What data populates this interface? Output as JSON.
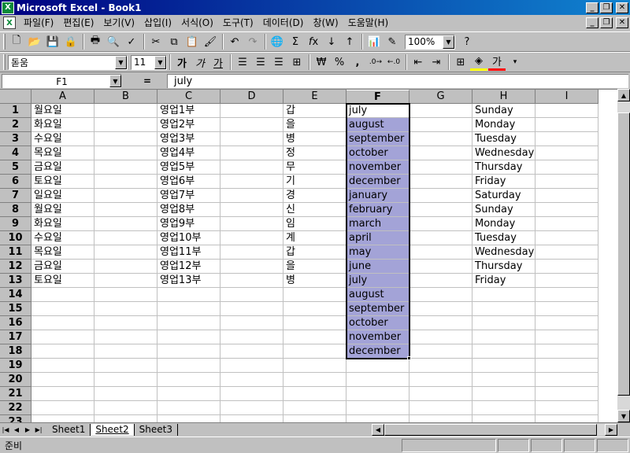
{
  "window": {
    "title": "Microsoft Excel - Book1",
    "app_icon": "excel-icon",
    "buttons": [
      "_",
      "❐",
      "✕"
    ]
  },
  "menu": {
    "items": [
      "파일(F)",
      "편집(E)",
      "보기(V)",
      "삽입(I)",
      "서식(O)",
      "도구(T)",
      "데이터(D)",
      "창(W)",
      "도움말(H)"
    ],
    "doc_buttons": [
      "_",
      "❐",
      "✕"
    ]
  },
  "standard_toolbar": {
    "zoom": "100%",
    "icons": [
      "new-icon",
      "open-icon",
      "save-icon",
      "permission-icon",
      "print-icon",
      "preview-icon",
      "spelling-icon",
      "cut-icon",
      "copy-icon",
      "paste-icon",
      "format-painter-icon",
      "undo-icon",
      "redo-icon",
      "hyperlink-icon",
      "autosum-icon",
      "function-icon",
      "sort-ascending-icon",
      "sort-descending-icon",
      "chart-wizard-icon",
      "drawing-icon",
      "help-icon"
    ]
  },
  "format_toolbar": {
    "font": "돋움",
    "size": "11",
    "bold": "가",
    "italic": "가",
    "underline": "가",
    "currency": "₩",
    "percent": "%",
    "comma": ",",
    "font_color_label": "가"
  },
  "formula_bar": {
    "name_box": "F1",
    "equals": "=",
    "content": "july"
  },
  "columns": [
    "A",
    "B",
    "C",
    "D",
    "E",
    "F",
    "G",
    "H",
    "I"
  ],
  "rows": [
    "1",
    "2",
    "3",
    "4",
    "5",
    "6",
    "7",
    "8",
    "9",
    "10",
    "11",
    "12",
    "13",
    "14",
    "15",
    "16",
    "17",
    "18",
    "19",
    "20",
    "21",
    "22",
    "23"
  ],
  "cells": {
    "A": [
      "월요일",
      "화요일",
      "수요일",
      "목요일",
      "금요일",
      "토요일",
      "일요일",
      "월요일",
      "화요일",
      "수요일",
      "목요일",
      "금요일",
      "토요일"
    ],
    "C": [
      "영업1부",
      "영업2부",
      "영업3부",
      "영업4부",
      "영업5부",
      "영업6부",
      "영업7부",
      "영업8부",
      "영업9부",
      "영업10부",
      "영업11부",
      "영업12부",
      "영업13부"
    ],
    "E": [
      "갑",
      "을",
      "병",
      "정",
      "무",
      "기",
      "경",
      "신",
      "임",
      "계",
      "갑",
      "을",
      "병"
    ],
    "F": [
      "july",
      "august",
      "september",
      "october",
      "november",
      "december",
      "january",
      "february",
      "march",
      "april",
      "may",
      "june",
      "july",
      "august",
      "september",
      "october",
      "november",
      "december"
    ],
    "H": [
      "Sunday",
      "Monday",
      "Tuesday",
      "Wednesday",
      "Thursday",
      "Friday",
      "Saturday",
      "Sunday",
      "Monday",
      "Tuesday",
      "Wednesday",
      "Thursday",
      "Friday"
    ]
  },
  "sheet_tabs": [
    "Sheet1",
    "Sheet2",
    "Sheet3"
  ],
  "active_tab": "Sheet2",
  "status": "준비",
  "colors": {
    "selection": "#a3a3d7",
    "title_bar": "#000080"
  }
}
